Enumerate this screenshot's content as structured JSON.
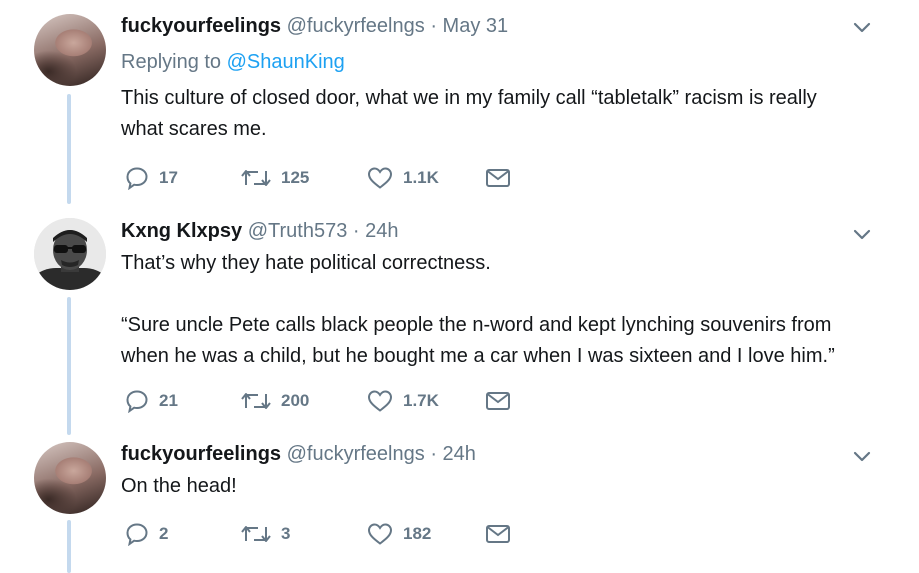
{
  "tweets": [
    {
      "name": "fuckyourfeelings",
      "handle": "@fuckyrfeelngs",
      "separator": "·",
      "time": "May 31",
      "replying_prefix": "Replying to",
      "replying_handle": "@ShaunKing",
      "text_lines": [
        "This culture of closed door, what we in my family call “tabletalk” racism is really",
        "what scares me."
      ],
      "replies": "17",
      "retweets": "125",
      "likes": "1.1K",
      "avatar_icon": "user-avatar-photo"
    },
    {
      "name": "Kxng Klxpsy",
      "handle": "@Truth573",
      "separator": "·",
      "time": "24h",
      "text_lines": [
        "That’s why they hate political correctness.",
        "",
        "“Sure uncle Pete calls black people the n-word and kept lynching souvenirs from",
        "when he was a child, but he bought me a car when I was sixteen and I love him.”"
      ],
      "replies": "21",
      "retweets": "200",
      "likes": "1.7K",
      "avatar_icon": "user-avatar-sunglasses"
    },
    {
      "name": "fuckyourfeelings",
      "handle": "@fuckyrfeelngs",
      "separator": "·",
      "time": "24h",
      "text_lines": [
        "On the head!"
      ],
      "replies": "2",
      "retweets": "3",
      "likes": "182",
      "avatar_icon": "user-avatar-photo"
    }
  ],
  "icons": {
    "reply": "reply-icon",
    "retweet": "retweet-icon",
    "like": "heart-icon",
    "dm": "envelope-icon",
    "caret": "chevron-down-icon"
  },
  "colors": {
    "text": "#14171a",
    "muted": "#657786",
    "link": "#1da1f2",
    "thread": "#c4d9ee"
  }
}
